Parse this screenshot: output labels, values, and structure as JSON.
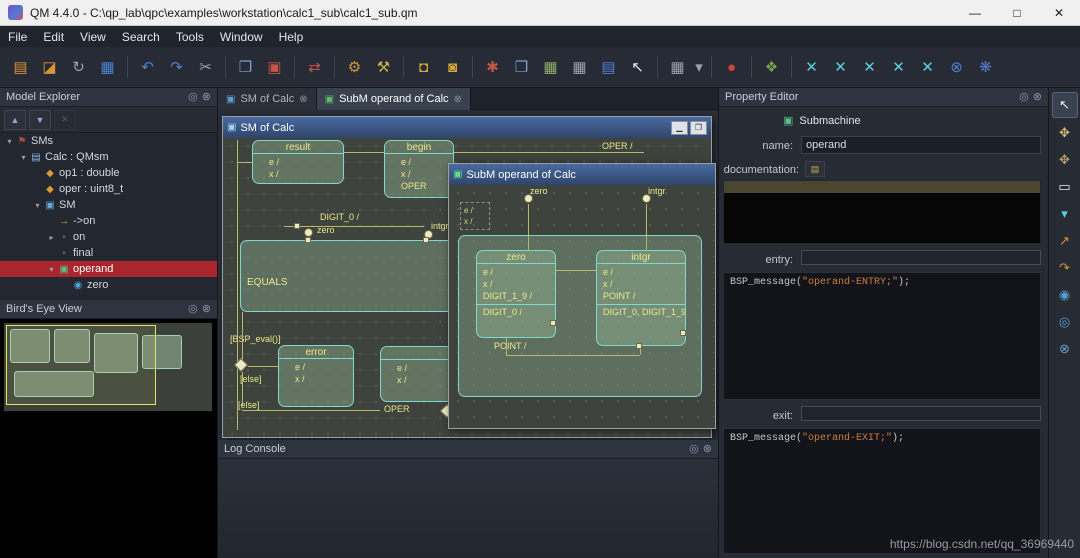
{
  "titlebar": {
    "title": "QM 4.4.0 - C:\\qp_lab\\qpc\\examples\\workstation\\calc1_sub\\calc1_sub.qm",
    "minimize": "—",
    "maximize": "□",
    "close": "✕"
  },
  "menubar": {
    "items": [
      "File",
      "Edit",
      "View",
      "Search",
      "Tools",
      "Window",
      "Help"
    ]
  },
  "icons": {
    "float": "◎",
    "close": "⊗"
  },
  "toolbar": {
    "items": [
      {
        "name": "new-model",
        "glyph": "▤"
      },
      {
        "name": "open-model",
        "glyph": "◪"
      },
      {
        "name": "reload",
        "glyph": "↻"
      },
      {
        "name": "save",
        "glyph": "▦"
      },
      {
        "name": "undo",
        "glyph": "↶"
      },
      {
        "name": "redo",
        "glyph": "↷"
      },
      {
        "name": "cut",
        "glyph": "✂"
      },
      {
        "name": "copy",
        "glyph": "❐"
      },
      {
        "name": "paste",
        "glyph": "▣"
      },
      {
        "name": "merge",
        "glyph": "⇄"
      },
      {
        "name": "generate-code",
        "glyph": "⚙"
      },
      {
        "name": "build",
        "glyph": "⚒"
      },
      {
        "name": "lock",
        "glyph": "◘"
      },
      {
        "name": "unlock",
        "glyph": "◙"
      },
      {
        "name": "critic",
        "glyph": "✱"
      },
      {
        "name": "window-view",
        "glyph": "❒"
      },
      {
        "name": "image-view",
        "glyph": "▦"
      },
      {
        "name": "image-copy",
        "glyph": "▦"
      },
      {
        "name": "log-view",
        "glyph": "▤"
      },
      {
        "name": "pointer-mode",
        "glyph": "↖"
      },
      {
        "name": "grid",
        "glyph": "▦"
      },
      {
        "name": "grid-caret",
        "glyph": "▾"
      },
      {
        "name": "record",
        "glyph": "●"
      },
      {
        "name": "palette",
        "glyph": "❖"
      },
      {
        "name": "tool-x-1",
        "glyph": "✕"
      },
      {
        "name": "tool-x-2",
        "glyph": "✕"
      },
      {
        "name": "tool-x-3",
        "glyph": "✕"
      },
      {
        "name": "tool-x-4",
        "glyph": "✕"
      },
      {
        "name": "tool-x-5",
        "glyph": "✕"
      },
      {
        "name": "cancel",
        "glyph": "⊗"
      },
      {
        "name": "qspy",
        "glyph": "❋"
      }
    ]
  },
  "explorer": {
    "title": "Model Explorer",
    "up": "▲",
    "down": "▼",
    "clear": "✕",
    "tree": [
      {
        "exp": "▾",
        "glyph": "⚑",
        "label": "SMs"
      },
      {
        "exp": "▾",
        "glyph": "▤",
        "label": "Calc : QMsm"
      },
      {
        "exp": "",
        "glyph": "◆",
        "label": "op1 : double"
      },
      {
        "exp": "",
        "glyph": "◆",
        "label": "oper : uint8_t"
      },
      {
        "exp": "▾",
        "glyph": "▣",
        "label": "SM"
      },
      {
        "exp": "",
        "glyph": "→",
        "label": "->on"
      },
      {
        "exp": "▸",
        "glyph": "▪",
        "label": "on"
      },
      {
        "exp": "",
        "glyph": "▪",
        "label": "final"
      },
      {
        "exp": "▾",
        "glyph": "▣",
        "label": "operand"
      },
      {
        "exp": "",
        "glyph": "◉",
        "label": "zero"
      }
    ]
  },
  "birdseye": {
    "title": "Bird's Eye View"
  },
  "tabs": {
    "tab1": {
      "icon": "▣",
      "label": "SM of Calc"
    },
    "tab2": {
      "icon": "▣",
      "label": "SubM operand of Calc"
    }
  },
  "mdi": {
    "win1": {
      "icon": "▣",
      "title": "SM of Calc",
      "min": "▁",
      "max": "❐"
    },
    "win2": {
      "icon": "▣",
      "title": "SubM operand of Calc"
    }
  },
  "diagram1": {
    "result": {
      "name": "result",
      "i1": "e /",
      "i2": "x /"
    },
    "begin": {
      "name": "begin",
      "i1": "e /",
      "i2": "x /",
      "i3": "OPER"
    },
    "oper_top": "OPER /",
    "digit0": "DIGIT_0 /",
    "ep_zero": "zero",
    "ep_intgr": "intgr",
    "equals": "EQUALS",
    "guard": "[BSP_eval()]",
    "else1": "[else]",
    "else2": "[else]",
    "error": {
      "name": "error",
      "i1": "e /",
      "i2": "x /"
    },
    "state2": {
      "i1": "e /",
      "i2": "x /"
    },
    "oper_bottom": "OPER"
  },
  "diagram2": {
    "ep_zero": "zero",
    "ep_intgr": "intgr",
    "corner": {
      "i1": "e /",
      "i2": "x /"
    },
    "zero": {
      "name": "zero",
      "i1": "e /",
      "i2": "x /",
      "i3": "DIGIT_1_9 /",
      "i4": "DIGIT_0 /"
    },
    "intgr": {
      "name": "intgr",
      "i1": "e /",
      "i2": "x /",
      "i3": "POINT /",
      "i4": "DIGIT_0, DIGIT_1_9"
    },
    "point": "POINT /"
  },
  "log": {
    "title": "Log Console"
  },
  "props": {
    "title": "Property Editor",
    "type_icon": "▣",
    "type_label": "Submachine",
    "name_label": "name:",
    "name_value": "operand",
    "doc_label": "documentation:",
    "doc_btn": "▤",
    "entry_label": "entry:",
    "entry_fn": "BSP_message(",
    "entry_str": "\"operand-ENTRY;\"",
    "entry_end": ");",
    "exit_label": "exit:",
    "exit_fn": "BSP_message(",
    "exit_str": "\"operand-EXIT;\"",
    "exit_end": ");"
  },
  "rail": {
    "items": [
      {
        "name": "select-tool",
        "glyph": "↖"
      },
      {
        "name": "pan-tool",
        "glyph": "✥"
      },
      {
        "name": "grab-tool",
        "glyph": "✥"
      },
      {
        "name": "state-tool",
        "glyph": "▭"
      },
      {
        "name": "more-tools",
        "glyph": "▾"
      },
      {
        "name": "transition-tool",
        "glyph": "↗"
      },
      {
        "name": "self-transition-tool",
        "glyph": "↷"
      },
      {
        "name": "initial-tool",
        "glyph": "◉"
      },
      {
        "name": "entry-point-tool",
        "glyph": "◎"
      },
      {
        "name": "exit-point-tool",
        "glyph": "⊗"
      }
    ]
  },
  "watermark": "https://blog.csdn.net/qq_36969440",
  "colors": {
    "selection_red": "#a8262c",
    "state_fill": "#96b996",
    "state_border": "#7fd8cc",
    "label_yellow": "#e9e98a",
    "code_string": "#cf7d3e",
    "mdi_title": "#4a6aa0"
  }
}
